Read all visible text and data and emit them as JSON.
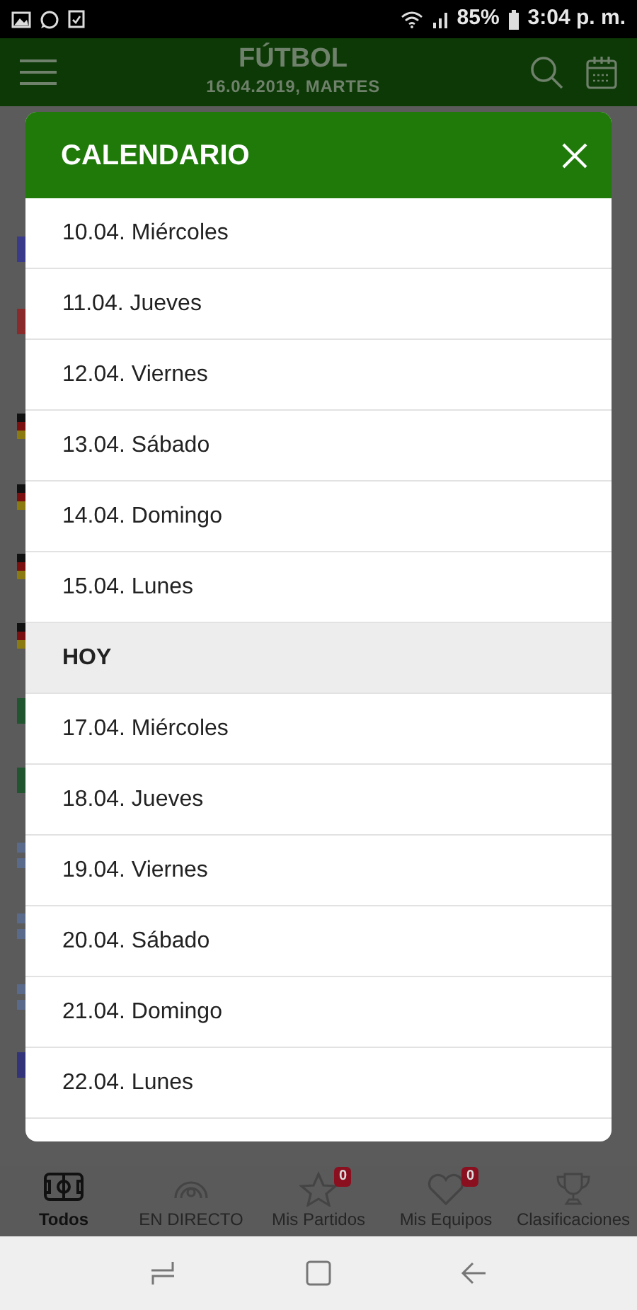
{
  "status_bar": {
    "battery": "85%",
    "time": "3:04 p. m."
  },
  "app_bar": {
    "title": "FÚTBOL",
    "subtitle": "16.04.2019, MARTES"
  },
  "calendar_dialog": {
    "title": "CALENDARIO",
    "days": [
      {
        "label": "10.04. Miércoles",
        "kind": "day"
      },
      {
        "label": "11.04. Jueves",
        "kind": "day"
      },
      {
        "label": "12.04. Viernes",
        "kind": "day"
      },
      {
        "label": "13.04. Sábado",
        "kind": "day"
      },
      {
        "label": "14.04. Domingo",
        "kind": "day"
      },
      {
        "label": "15.04. Lunes",
        "kind": "day"
      },
      {
        "label": "HOY",
        "kind": "today"
      },
      {
        "label": "17.04. Miércoles",
        "kind": "day"
      },
      {
        "label": "18.04. Jueves",
        "kind": "day"
      },
      {
        "label": "19.04. Viernes",
        "kind": "day"
      },
      {
        "label": "20.04. Sábado",
        "kind": "day"
      },
      {
        "label": "21.04. Domingo",
        "kind": "day"
      },
      {
        "label": "22.04. Lunes",
        "kind": "day"
      }
    ]
  },
  "bottom_nav": [
    {
      "label": "Todos",
      "selected": true,
      "kind": "field"
    },
    {
      "label": "EN DIRECTO",
      "selected": false,
      "kind": "live"
    },
    {
      "label": "Mis Partidos",
      "selected": false,
      "kind": "star",
      "badge": "0"
    },
    {
      "label": "Mis Equipos",
      "selected": false,
      "kind": "heart",
      "badge": "0"
    },
    {
      "label": "Clasificaciones",
      "selected": false,
      "kind": "trophy"
    }
  ]
}
